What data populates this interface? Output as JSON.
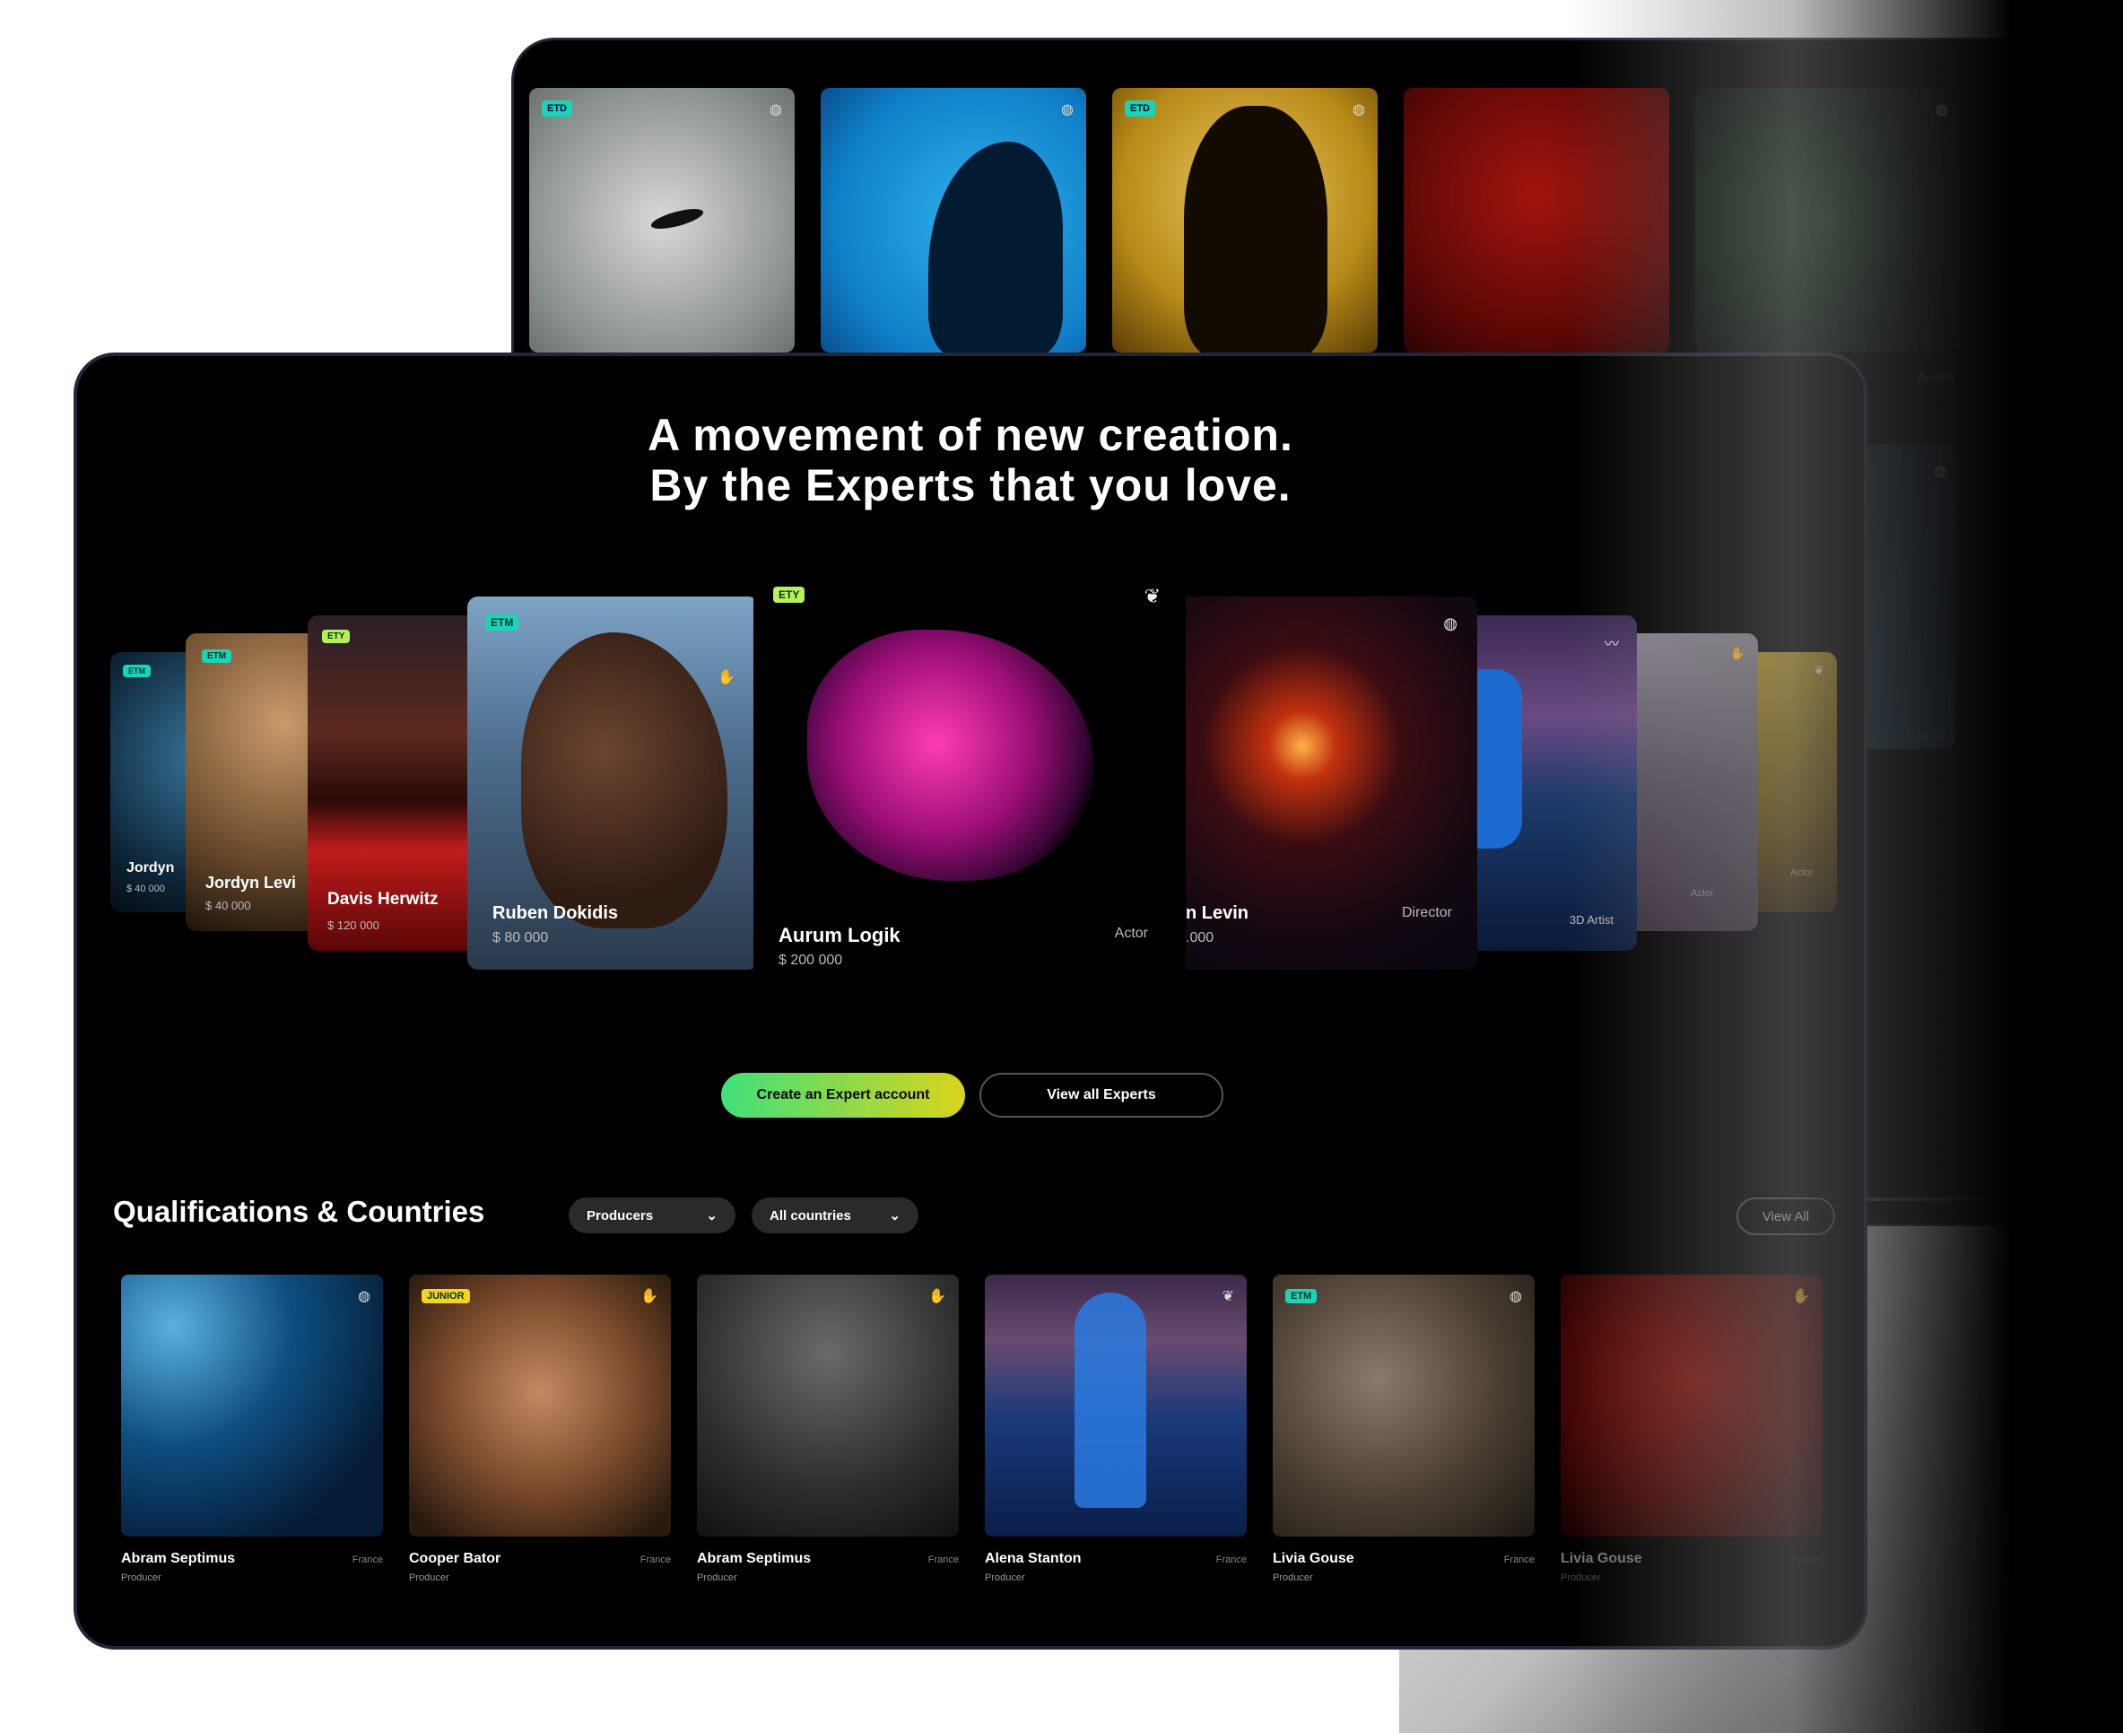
{
  "back_window": {
    "cards": [
      {
        "tag": "ETD",
        "icon": "globe-icon"
      },
      {
        "tag": "",
        "icon": "globe-icon"
      },
      {
        "tag": "ETD",
        "icon": "globe-icon"
      },
      {
        "tag": "",
        "icon": ""
      },
      {
        "tag": "",
        "icon": "globe-icon"
      }
    ],
    "labels": [
      "Austria",
      "Mexico"
    ]
  },
  "hero": {
    "line1": "A movement of new creation.",
    "line2": "By the Experts that you love."
  },
  "carousel": [
    {
      "tag": "ETM",
      "name": "Jordyn",
      "price": "$ 40 000",
      "role": ""
    },
    {
      "tag": "ETM",
      "name": "Jordyn Levi",
      "price": "$ 40 000",
      "role": ""
    },
    {
      "tag": "ETY",
      "name": "Davis Herwitz",
      "price": "$ 120 000",
      "role": ""
    },
    {
      "tag": "ETM",
      "name": "Ruben Dokidis",
      "price": "$ 80 000",
      "role": ""
    },
    {
      "tag": "ETY",
      "name": "Aurum Logik",
      "price": "$ 200 000",
      "role": "Actor"
    },
    {
      "tag": "",
      "name": "n Levin",
      "price": ".000",
      "role": "Director"
    },
    {
      "tag": "",
      "name": "",
      "price": "",
      "role": "3D Artist"
    },
    {
      "tag": "",
      "name": "",
      "price": "",
      "role": "Actor"
    },
    {
      "tag": "",
      "name": "",
      "price": "",
      "role": "Actor"
    }
  ],
  "buttons": {
    "create": "Create an Expert account",
    "view_experts": "View all Experts"
  },
  "section": {
    "title": "Qualifications & Countries",
    "filter1": "Producers",
    "filter2": "All countries",
    "view_all": "View All"
  },
  "grid": [
    {
      "tag": "",
      "name": "Abram Septimus",
      "country": "France",
      "role": "Producer",
      "icon": "globe-icon"
    },
    {
      "tag": "JUNIOR",
      "name": "Cooper Bator",
      "country": "France",
      "role": "Producer",
      "icon": "hand-icon"
    },
    {
      "tag": "",
      "name": "Abram Septimus",
      "country": "France",
      "role": "Producer",
      "icon": "hand-icon"
    },
    {
      "tag": "",
      "name": "Alena Stanton",
      "country": "France",
      "role": "Producer",
      "icon": "feather-icon"
    },
    {
      "tag": "ETM",
      "name": "Livia Gouse",
      "country": "France",
      "role": "Producer",
      "icon": "globe-icon"
    },
    {
      "tag": "",
      "name": "Livia Gouse",
      "country": "France",
      "role": "Producer",
      "icon": "hand-icon"
    }
  ],
  "colors": {
    "tag_teal": "#18d4b8",
    "tag_lime": "#b8f05a",
    "tag_yellow": "#f5d420",
    "cta_start": "#3fe07b",
    "cta_end": "#d9d41c"
  }
}
